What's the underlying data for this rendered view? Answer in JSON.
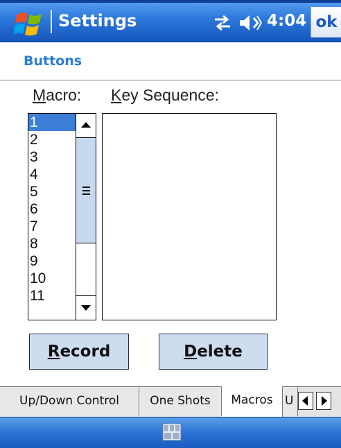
{
  "titlebar": {
    "app_title": "Settings",
    "clock": "4:04",
    "ok_label": "ok",
    "icons": [
      "windows-start-icon",
      "connectivity-icon",
      "volume-icon"
    ],
    "colors": {
      "bar": "#2c78dc",
      "text": "#ffffff"
    }
  },
  "page": {
    "title": "Buttons",
    "title_color": "#2b7bd6"
  },
  "macro_label": {
    "first": "M",
    "rest": "acro:"
  },
  "keyseq_label": {
    "first": "K",
    "rest": "ey Sequence:"
  },
  "macro_list": {
    "items": [
      "1",
      "2",
      "3",
      "4",
      "5",
      "6",
      "7",
      "8",
      "9",
      "10",
      "11"
    ],
    "selected": "1",
    "selection_color": "#3d7fd8",
    "scrollbar_icons": [
      "scroll-up-icon",
      "scroll-thumb-grip-icon",
      "scroll-down-icon"
    ]
  },
  "key_sequence": {
    "value": ""
  },
  "buttons": {
    "record": {
      "first": "R",
      "rest": "ecord"
    },
    "delete": {
      "first": "D",
      "rest": "elete"
    },
    "color": "#cddcee"
  },
  "tabs": [
    {
      "label": "Up/Down Control",
      "active": false
    },
    {
      "label": "One Shots",
      "active": false
    },
    {
      "label": "Macros",
      "active": true
    },
    {
      "label": "U",
      "active": false
    }
  ],
  "tab_scroll_icons": [
    "tab-scroll-left-icon",
    "tab-scroll-right-icon"
  ],
  "bottombar": {
    "icon": "keyboard-input-icon"
  }
}
